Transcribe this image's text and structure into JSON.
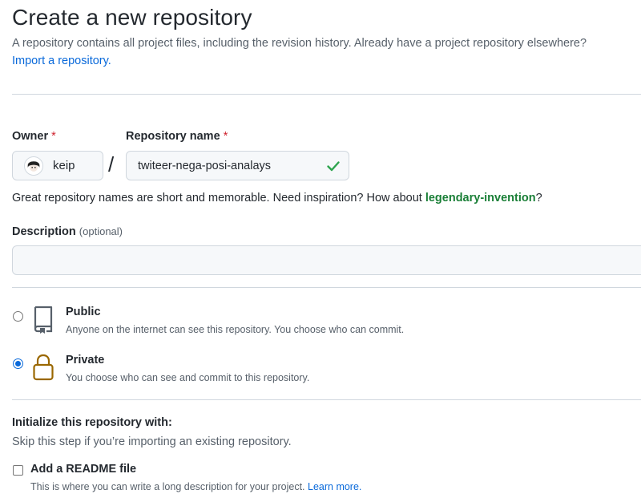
{
  "header": {
    "title": "Create a new repository",
    "subtitle": "A repository contains all project files, including the revision history. Already have a project repository elsewhere?",
    "import_link": "Import a repository."
  },
  "owner": {
    "label": "Owner",
    "required_mark": "*",
    "value": "keip"
  },
  "separator": "/",
  "repository": {
    "label": "Repository name",
    "required_mark": "*",
    "value": "twiteer-nega-posi-analays",
    "status_icon": "check-icon",
    "status_color": "#2da44e"
  },
  "name_hint": {
    "text": "Great repository names are short and memorable. Need inspiration? How about ",
    "suggestion": "legendary-invention",
    "suffix": "?"
  },
  "description": {
    "label": "Description",
    "optional": "(optional)",
    "value": ""
  },
  "visibility": {
    "options": [
      {
        "title": "Public",
        "desc": "Anyone on the internet can see this repository. You choose who can commit.",
        "icon": "repo-book-icon",
        "selected": false
      },
      {
        "title": "Private",
        "desc": "You choose who can see and commit to this repository.",
        "icon": "lock-icon",
        "selected": true
      }
    ]
  },
  "initialize": {
    "title": "Initialize this repository with:",
    "subtitle": "Skip this step if you’re importing an existing repository.",
    "readme_label": "Add a README file",
    "readme_desc": "This is where you can write a long description for your project. ",
    "learn_more": "Learn more."
  },
  "colors": {
    "link": "#0969da",
    "suggestion": "#1a7f37",
    "required": "#cf222e",
    "lock": "#9a6700"
  }
}
